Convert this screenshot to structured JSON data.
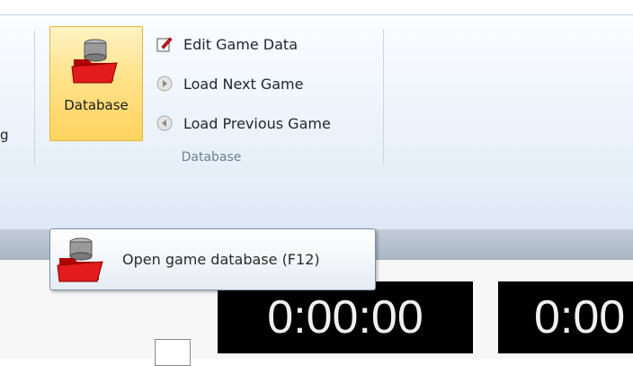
{
  "ribbon": {
    "partial_left_label": "g",
    "database_button_label": "Database",
    "commands": [
      {
        "label": "Edit Game Data",
        "icon": "edit-icon"
      },
      {
        "label": "Load Next Game",
        "icon": "next-arrow-icon"
      },
      {
        "label": "Load Previous Game",
        "icon": "previous-arrow-icon"
      }
    ],
    "group_label": "Database"
  },
  "tooltip": {
    "text": "Open game database (F12)",
    "icon": "database-folder-icon"
  },
  "clocks": [
    {
      "value": "0:00:00"
    },
    {
      "value": "0:00"
    }
  ],
  "colors": {
    "button_highlight": "#ffd35e",
    "clock_background": "#000000",
    "clock_text": "#f0f0f0"
  }
}
